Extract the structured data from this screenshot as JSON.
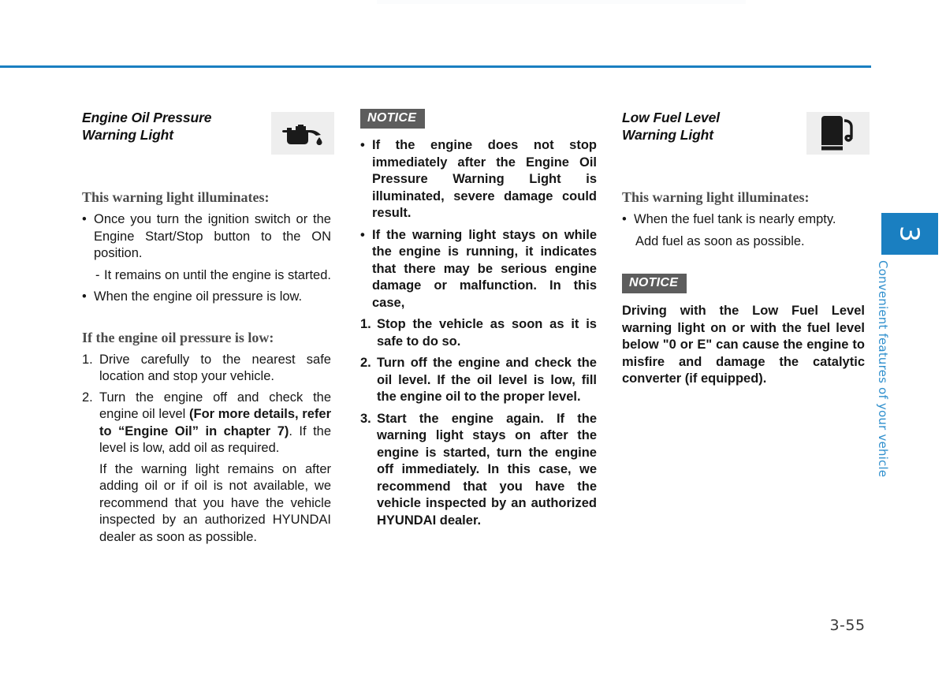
{
  "page": {
    "number": "3-55",
    "accent_color": "#1a7fc1",
    "notice_badge_color": "#5d5d5d"
  },
  "chapter_tab": {
    "number": "3",
    "title": "Convenient features of your vehicle"
  },
  "columns": {
    "col1": {
      "title": "Engine Oil Pressure\nWarning Light",
      "title_line1": "Engine Oil Pressure",
      "title_line2": "Warning Light",
      "icon": "oil-can-icon",
      "lead1": "This warning light illuminates:",
      "bullet1_mark": "•",
      "bullet1": "Once you turn the ignition switch or the Engine Start/Stop button to the ON position.",
      "dash1_mark": "-",
      "dash1": "It remains on until the engine is started.",
      "bullet2_mark": "•",
      "bullet2": "When the engine oil pressure is low.",
      "lead2": "If the engine oil pressure is low:",
      "item1_mark": "1.",
      "item1": "Drive carefully to the nearest safe location and stop your vehicle.",
      "item2_mark": "2.",
      "item2_a": "Turn the engine off and check the engine oil level ",
      "item2_bold": "(For more details, refer to “Engine Oil” in chapter 7)",
      "item2_b": ". If the level is low, add oil as required.",
      "item2_para2": "If the warning light remains on after adding oil or if oil is not available, we recommend that you have the vehicle inspected by an authorized HYUNDAI dealer as soon as possible."
    },
    "col2": {
      "notice_label": "NOTICE",
      "n_b1_mark": "•",
      "n_b1": "If the engine does not stop immediately after the Engine Oil Pressure Warning Light is illuminated, severe damage could result.",
      "n_b2_mark": "•",
      "n_b2": "If the warning light stays on while the engine is running, it indicates that there may be serious engine damage or malfunction. In this case,",
      "n_i1_mark": "1.",
      "n_i1": "Stop the vehicle as soon as it is safe to do so.",
      "n_i2_mark": "2.",
      "n_i2": "Turn off the engine and check the oil level. If the oil level is low, fill the engine oil to the proper level.",
      "n_i3_mark": "3.",
      "n_i3": "Start the engine again. If the warning light stays on after the engine is started, turn the engine off immediately. In this case, we recommend that you have the vehicle inspected by an authorized HYUNDAI dealer."
    },
    "col3": {
      "title_line1": "Low Fuel Level",
      "title_line2": "Warning Light",
      "icon": "fuel-pump-icon",
      "lead1": "This warning light illuminates:",
      "bullet1_mark": "•",
      "bullet1": "When the fuel tank is nearly empty.",
      "bullet1_cont": "Add fuel as soon as possible.",
      "notice_label": "NOTICE",
      "notice_text": "Driving with the Low Fuel Level warning light on or with the fuel level below \"0 or E\" can cause the engine to misfire and damage the catalytic converter (if equipped)."
    }
  }
}
